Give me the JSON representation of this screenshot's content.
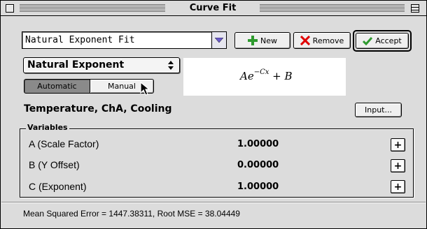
{
  "window": {
    "title": "Curve Fit"
  },
  "toolbar": {
    "fit_name": "Natural Exponent Fit",
    "new_label": "New",
    "remove_label": "Remove",
    "accept_label": "Accept"
  },
  "model": {
    "selected": "Natural Exponent",
    "mode_automatic": "Automatic",
    "mode_manual": "Manual",
    "active_mode": "Automatic"
  },
  "equation": {
    "base": "Ae",
    "exponent": "−Cx",
    "tail": " + B"
  },
  "dataset": {
    "name": "Temperature, ChA, Cooling",
    "input_label": "Input..."
  },
  "variables": {
    "label": "Variables",
    "items": [
      {
        "name": "A (Scale Factor)",
        "value": "1.00000"
      },
      {
        "name": "B (Y Offset)",
        "value": "0.00000"
      },
      {
        "name": "C (Exponent)",
        "value": "1.00000"
      }
    ],
    "plus_label": "+"
  },
  "status": {
    "text": "Mean Squared Error = 1447.38311, Root MSE = 38.04449"
  },
  "icons": {
    "new": "green-plus-icon",
    "remove": "red-x-icon",
    "accept": "green-check-icon"
  },
  "colors": {
    "new_icon": "#2e9a2e",
    "remove_icon": "#e00000",
    "accept_icon": "#2e9a2e",
    "arrow": "#6a5acd"
  }
}
